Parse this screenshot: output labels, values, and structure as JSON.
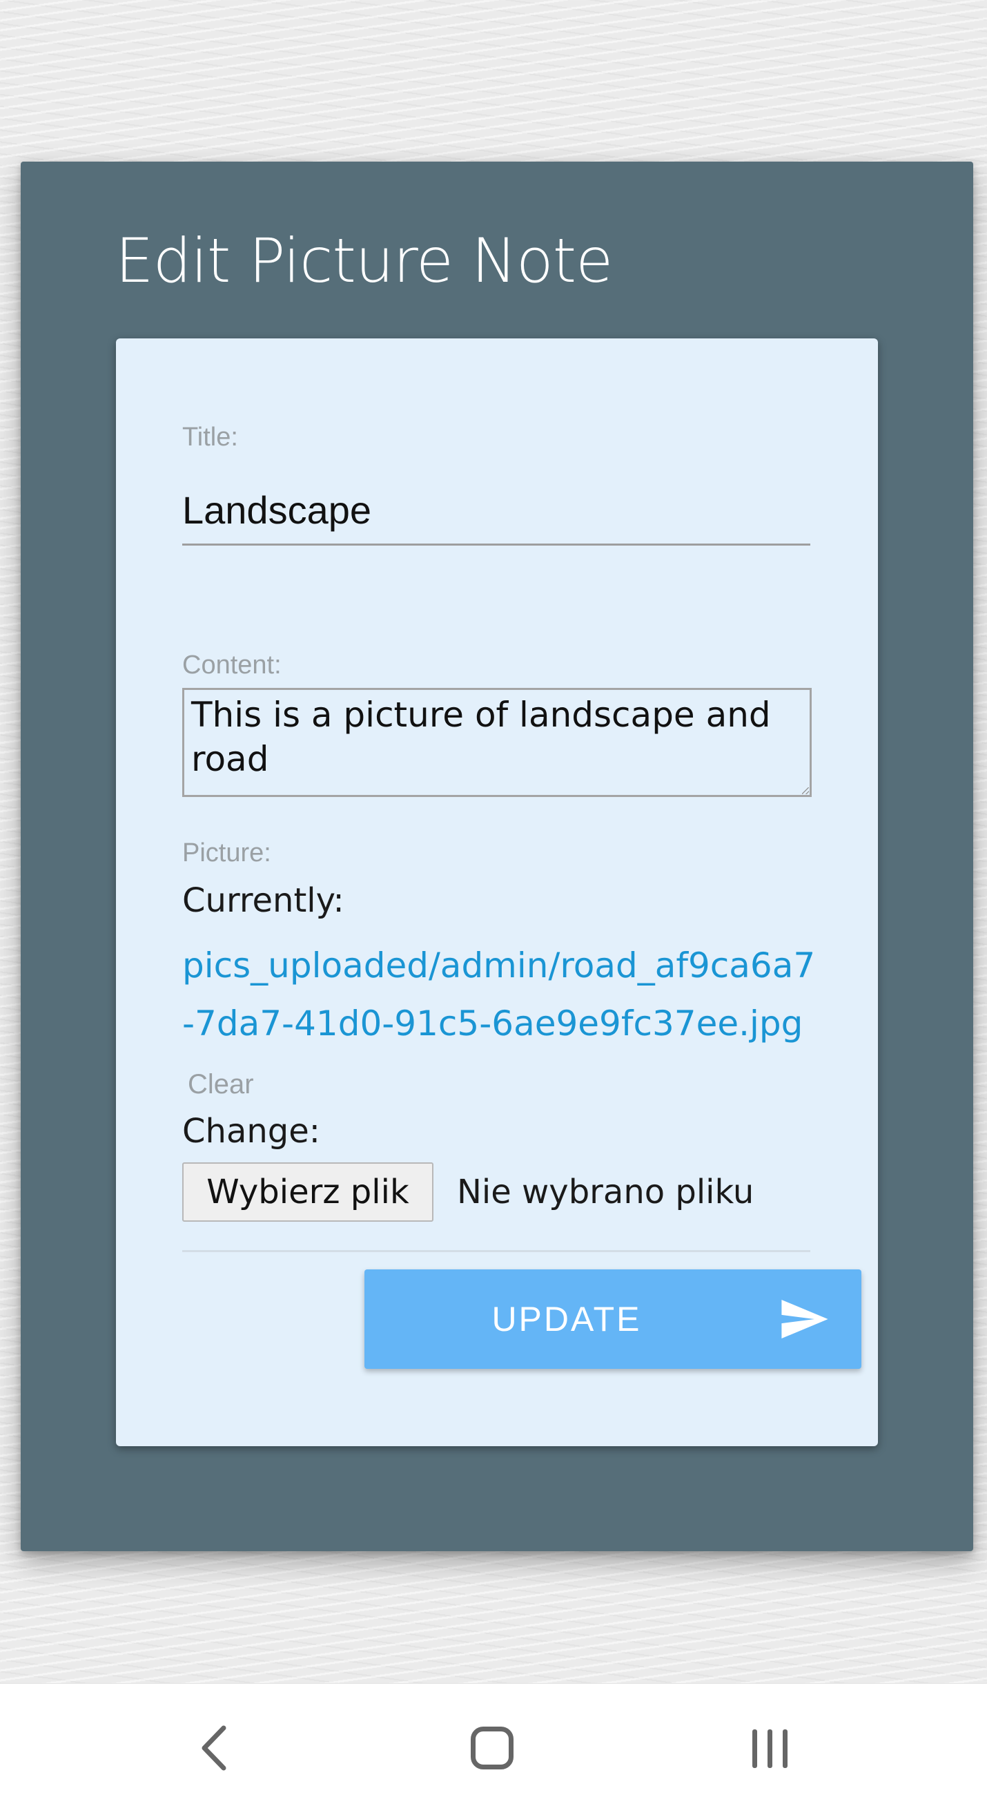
{
  "page": {
    "title": "Edit Picture Note"
  },
  "form": {
    "title_label": "Title:",
    "title_value": "Landscape",
    "content_label": "Content:",
    "content_value": "This is a picture of landscape and road",
    "picture_label": "Picture:",
    "currently_label": "Currently:",
    "current_file": "pics_uploaded/admin/road_af9ca6a7-7da7-41d0-91c5-6ae9e9fc37ee.jpg",
    "clear_label": "Clear",
    "change_label": "Change:",
    "choose_file_label": "Wybierz plik",
    "no_file_text": "Nie wybrano pliku",
    "submit_label": "UPDATE"
  },
  "icons": {
    "submit_icon": "send-icon",
    "nav_back": "back-icon",
    "nav_home": "home-icon",
    "nav_recents": "recents-icon"
  },
  "colors": {
    "outer_card": "#566e79",
    "inner_card": "#e3f0fb",
    "link": "#1a95d4",
    "button": "#64b5f6"
  }
}
